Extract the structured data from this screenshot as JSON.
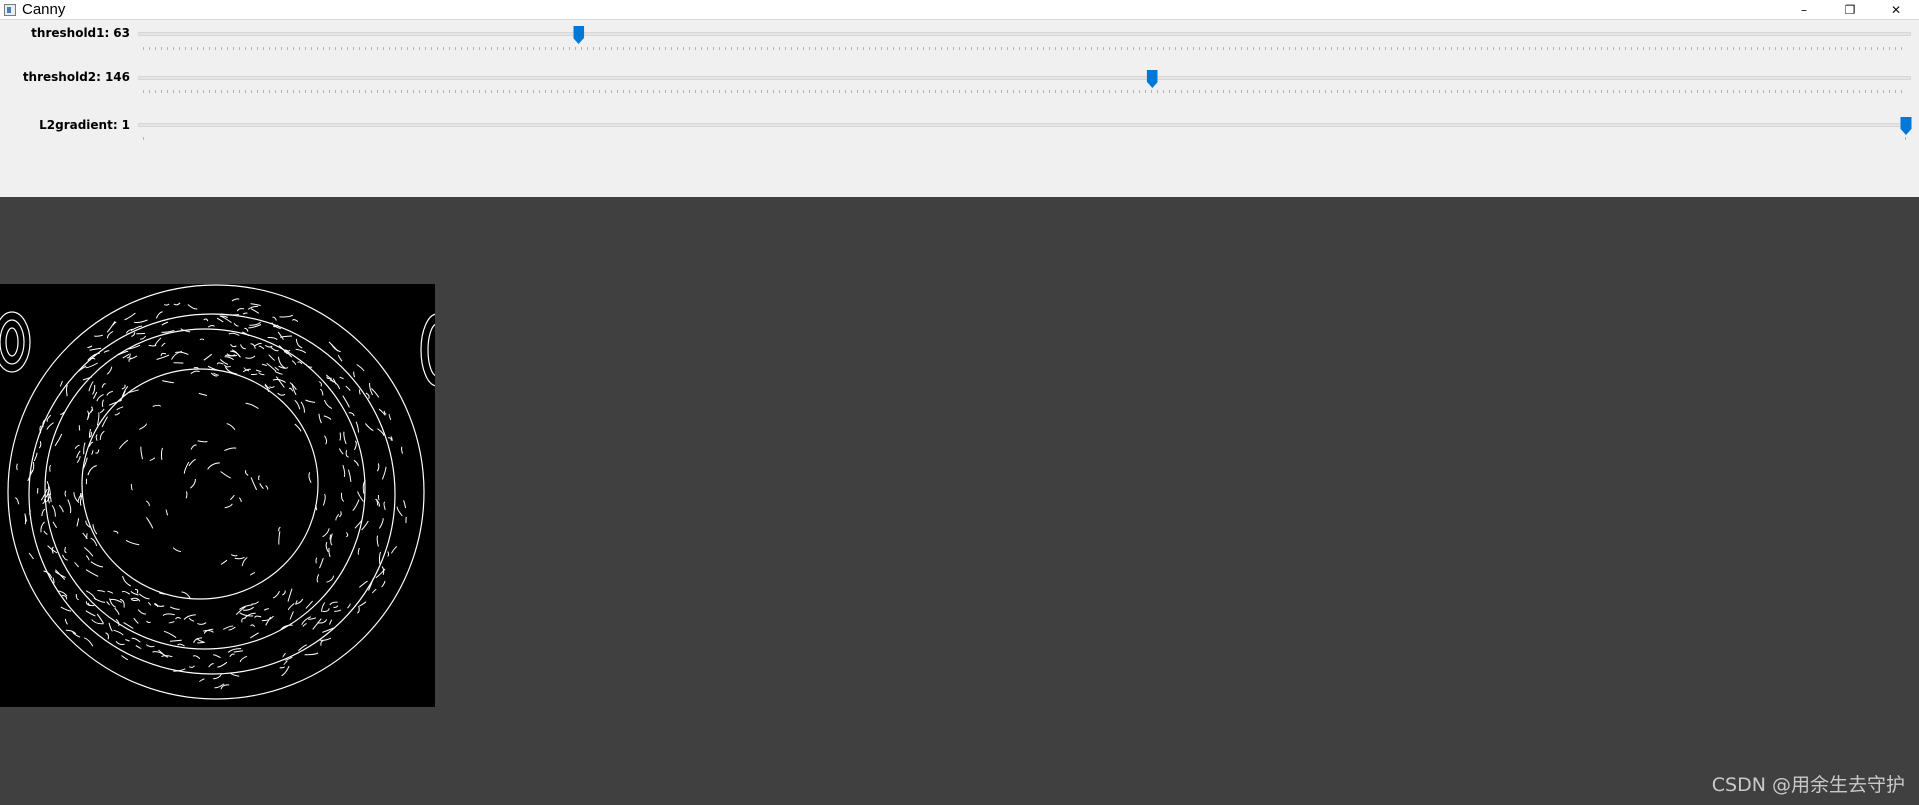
{
  "window": {
    "title": "Canny",
    "controls": {
      "minimize": "–",
      "restore": "❐",
      "close": "✕"
    }
  },
  "trackbars": [
    {
      "name": "threshold1",
      "label": "threshold1:",
      "value": 63,
      "max": 255
    },
    {
      "name": "threshold2",
      "label": "threshold2:",
      "value": 146,
      "max": 255
    },
    {
      "name": "L2gradient",
      "label": "L2gradient:",
      "value": 1,
      "max": 1
    }
  ],
  "colors": {
    "panel": "#f0f0f0",
    "canvas": "#404040",
    "thumb": "#0078d7",
    "image_bg": "#000000",
    "edges": "#ffffff"
  },
  "image": {
    "description_icon": "canny-edge-output-image"
  },
  "watermark": "CSDN @用余生去守护"
}
